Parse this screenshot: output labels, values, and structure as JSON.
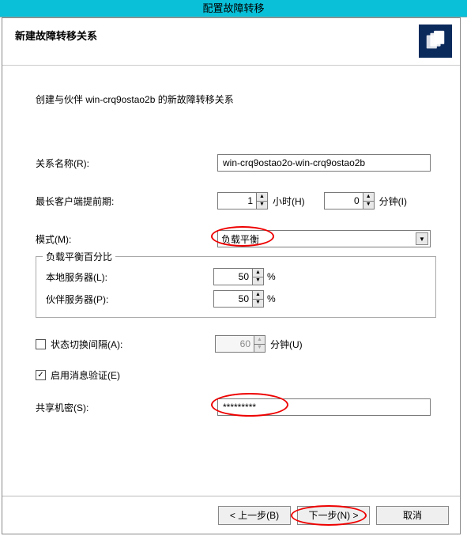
{
  "titlebar": "配置故障转移",
  "subtitle": "新建故障转移关系",
  "intro": "创建与伙伴 win-crq9ostao2b 的新故障转移关系",
  "labels": {
    "relation_name": "关系名称(R):",
    "max_lead": "最长客户端提前期:",
    "hours_unit": "小时(H)",
    "minutes_unit": "分钟(I)",
    "mode": "模式(M):",
    "lb_group": "负载平衡百分比",
    "local_server": "本地服务器(L):",
    "partner_server": "伙伴服务器(P):",
    "state_switch": "状态切换间隔(A):",
    "state_switch_unit": "分钟(U)",
    "enable_msg_auth": "启用消息验证(E)",
    "shared_secret": "共享机密(S):"
  },
  "values": {
    "relation_name": "win-crq9ostao2o-win-crq9ostao2b",
    "hours": "1",
    "minutes": "0",
    "mode": "负载平衡",
    "local_pct": "50",
    "partner_pct": "50",
    "state_switch_min": "60",
    "shared_secret": "*********",
    "msg_auth_checked": "✓"
  },
  "buttons": {
    "prev": "< 上一步(B)",
    "next": "下一步(N) >",
    "cancel": "取消"
  }
}
